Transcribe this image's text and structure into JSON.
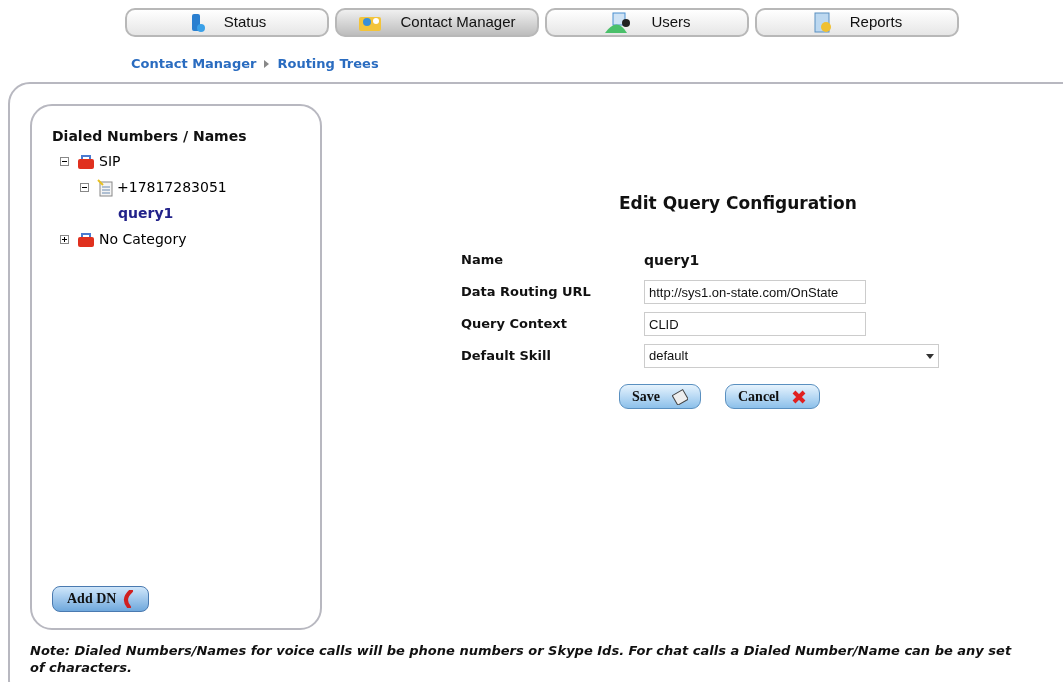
{
  "tabs": [
    {
      "label": "Status",
      "kind": "status",
      "selected": false
    },
    {
      "label": "Contact Manager",
      "kind": "contacts",
      "selected": true
    },
    {
      "label": "Users",
      "kind": "users",
      "selected": false
    },
    {
      "label": "Reports",
      "kind": "reports",
      "selected": false
    }
  ],
  "breadcrumb": [
    "Contact Manager",
    "Routing Trees"
  ],
  "tree": {
    "title": "Dialed Numbers / Names",
    "items": [
      {
        "kind": "category",
        "label": "SIP",
        "expanded": true,
        "children": [
          {
            "kind": "number",
            "label": "+17817283051",
            "expanded": true,
            "children": [
              {
                "kind": "query",
                "label": "query1"
              }
            ]
          }
        ]
      },
      {
        "kind": "category",
        "label": "No Category",
        "expanded": false
      }
    ]
  },
  "add_button": "Add DN",
  "form": {
    "title": "Edit Query Configuration",
    "fields": [
      {
        "kind": "static",
        "label": "Name",
        "value": "query1"
      },
      {
        "kind": "input",
        "label": "Data Routing URL",
        "value": "http://sys1.on-state.com/OnState"
      },
      {
        "kind": "input",
        "label": "Query Context",
        "value": "CLID"
      },
      {
        "kind": "select",
        "label": "Default Skill",
        "value": "default"
      }
    ],
    "buttons": [
      {
        "label": "Save",
        "kind": "save"
      },
      {
        "label": "Cancel",
        "kind": "cancel"
      }
    ]
  },
  "note": "Note: Dialed Numbers/Names for voice calls will be phone numbers or Skype Ids. For chat calls a Dialed Number/Name can be any set of characters."
}
